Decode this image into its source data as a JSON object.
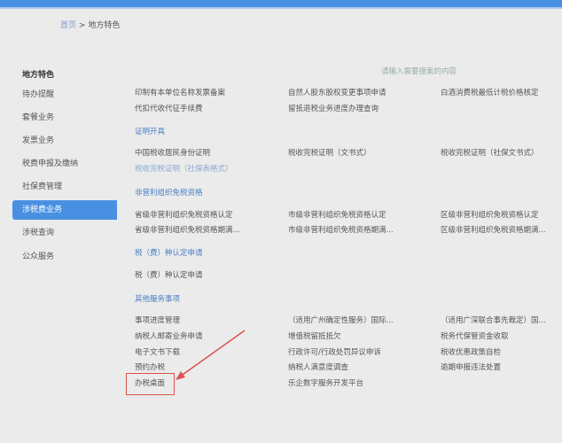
{
  "breadcrumb": {
    "home": "首页",
    "sep": ">",
    "current": "地方特色"
  },
  "sidebar": {
    "items": [
      {
        "label": "地方特色"
      },
      {
        "label": "待办提醒"
      },
      {
        "label": "套餐业务"
      },
      {
        "label": "发票业务"
      },
      {
        "label": "税费申报及缴纳"
      },
      {
        "label": "社保费管理"
      },
      {
        "label": "涉税费业务",
        "active": true
      },
      {
        "label": "涉税查询"
      },
      {
        "label": "公众服务"
      }
    ]
  },
  "search": {
    "placeholder": "请输入需要搜索的内容"
  },
  "top_items": [
    "印制有本单位名称发票备案",
    "自然人股东股权变更事项申请",
    "白酒消费税最低计税价格核定",
    "代扣代收代征手续费",
    "留抵退税业务进度办理查询"
  ],
  "sections": [
    {
      "title": "证明开具",
      "items": [
        "中国税收居民身份证明",
        "税收完税证明（文书式）",
        "税收完税证明（社保文书式）",
        "税收完税证明（社保表格式）"
      ]
    },
    {
      "title": "非营利组织免税资格",
      "items": [
        "省级非营利组织免税资格认定",
        "市级非营利组织免税资格认定",
        "区级非营利组织免税资格认定",
        "省级非营利组织免税资格期满...",
        "市级非营利组织免税资格期满...",
        "区级非营利组织免税资格期满..."
      ]
    },
    {
      "title": "税（费）种认定申请",
      "items": [
        "税（费）种认定申请"
      ]
    },
    {
      "title": "其他服务事项",
      "items": [
        "事项进度管理",
        "（适用广州确定性服务）国际...",
        "（适用广深联合事先裁定）国...",
        "纳税人邮寄业务申请",
        "增值税留抵抵欠",
        "税务代保管资金收取",
        "电子文书下载",
        "行政许可/行政处罚异议申诉",
        "税收优惠政策自检",
        "预约办税",
        "纳税人满意度调查",
        "逾期申报违法处置",
        "办税桌面",
        "乐企数字服务开发平台"
      ]
    }
  ],
  "colors": {
    "accent": "#4a90e2",
    "highlight": "#d9534f"
  }
}
